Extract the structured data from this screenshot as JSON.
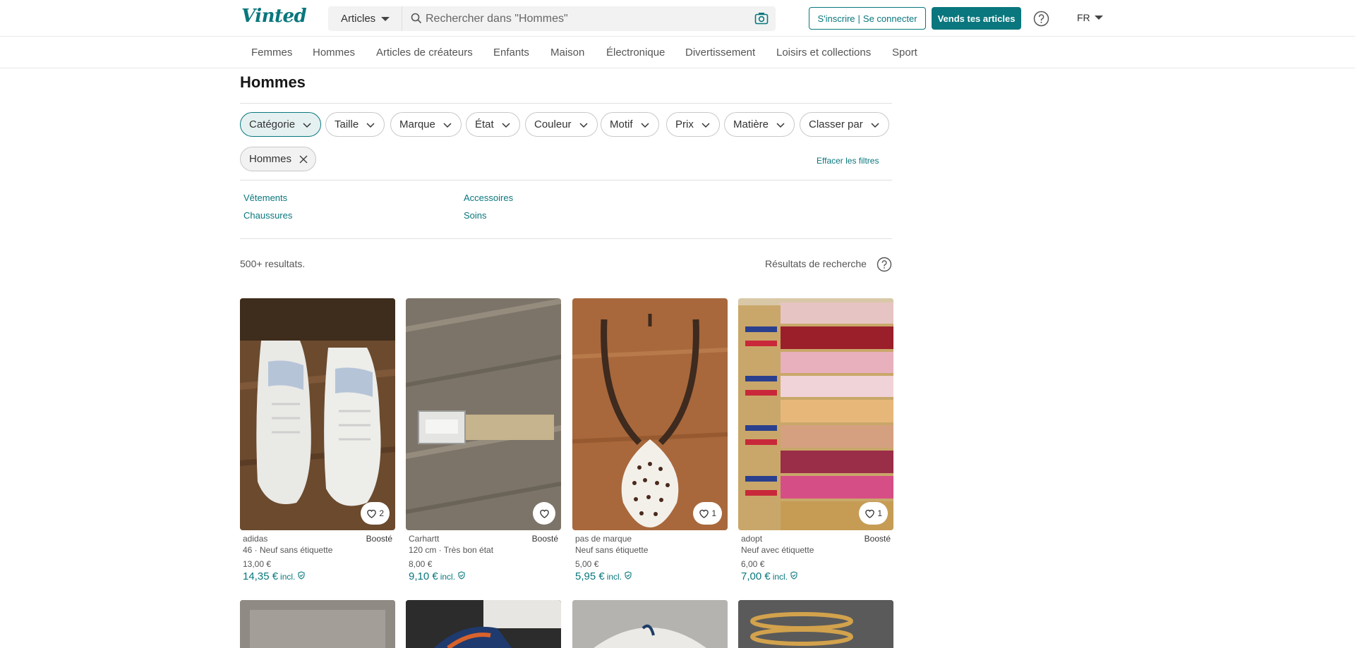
{
  "header": {
    "logo": "Vinted",
    "search_category": "Articles",
    "search_placeholder": "Rechercher dans \"Hommes\"",
    "signup_label": "S'inscrire",
    "login_label": "Se connecter",
    "sell_label": "Vends tes articles",
    "language": "FR"
  },
  "nav": [
    "Femmes",
    "Hommes",
    "Articles de créateurs",
    "Enfants",
    "Maison",
    "Électronique",
    "Divertissement",
    "Loisirs et collections",
    "Sport"
  ],
  "page": {
    "title": "Hommes",
    "filters": [
      "Catégorie",
      "Taille",
      "Marque",
      "État",
      "Couleur",
      "Motif",
      "Prix",
      "Matière",
      "Classer par"
    ],
    "active_filter_chip": "Hommes",
    "clear_filters": "Effacer les filtres",
    "subcategories": [
      "Vêtements",
      "Accessoires",
      "Chaussures",
      "Soins"
    ],
    "results_count": "500+ resultats.",
    "results_label": "Résultats de recherche"
  },
  "items": [
    {
      "brand": "adidas",
      "boosted": "Boosté",
      "meta": "46 · Neuf sans étiquette",
      "price": "13,00 €",
      "price_incl": "14,35 €",
      "incl": "incl.",
      "likes": "2"
    },
    {
      "brand": "Carhartt",
      "boosted": "Boosté",
      "meta": "120 cm · Très bon état",
      "price": "8,00 €",
      "price_incl": "9,10 €",
      "incl": "incl.",
      "likes": ""
    },
    {
      "brand": "pas de marque",
      "boosted": "",
      "meta": "Neuf sans étiquette",
      "price": "5,00 €",
      "price_incl": "5,95 €",
      "incl": "incl.",
      "likes": "1"
    },
    {
      "brand": "adopt",
      "boosted": "Boosté",
      "meta": "Neuf avec étiquette",
      "price": "6,00 €",
      "price_incl": "7,00 €",
      "incl": "incl.",
      "likes": "1"
    }
  ],
  "colors": {
    "accent": "#09777d",
    "border": "#e8e8e8"
  }
}
